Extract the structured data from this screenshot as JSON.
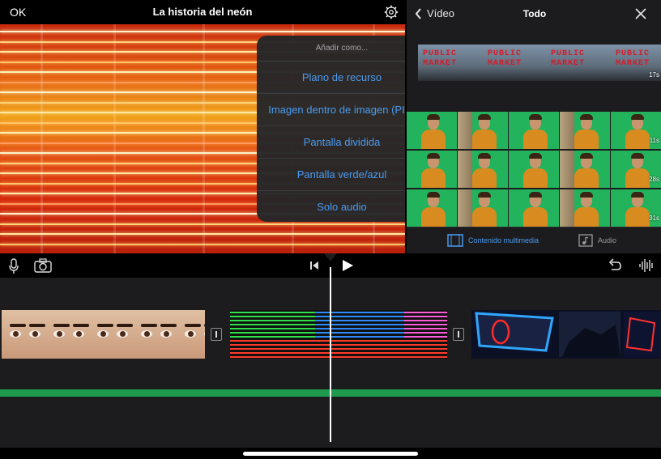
{
  "viewer": {
    "ok_label": "OK",
    "project_title": "La historia del neón"
  },
  "popover": {
    "title": "Añadir como...",
    "items": [
      "Plano de recurso",
      "Imagen dentro de imagen (PIP)",
      "Pantalla dividida",
      "Pantalla verde/azul",
      "Solo audio"
    ]
  },
  "browser": {
    "back_label": "Vídeo",
    "title": "Todo",
    "clips": [
      {
        "kind": "public-market",
        "duration": "17s"
      },
      {
        "kind": "green-screen-row",
        "duration": "11s"
      },
      {
        "kind": "green-screen-row",
        "duration": "28s"
      },
      {
        "kind": "green-screen-row",
        "duration": "31s"
      }
    ],
    "market_sign_words": [
      "PUBLIC",
      "MARKET"
    ],
    "tabs": {
      "media": "Contenido multimedia",
      "audio": "Audio"
    }
  },
  "icons": [
    "gear-icon",
    "chevron-left-icon",
    "close-icon",
    "film-icon",
    "music-note-icon",
    "microphone-icon",
    "camera-icon",
    "skip-back-icon",
    "play-icon",
    "undo-icon",
    "waveform-icon"
  ],
  "colors": {
    "accent": "#4a9bf0",
    "green_screen": "#23b35c",
    "audio_track": "#1e9a4e",
    "background": "#1c1c1e"
  }
}
